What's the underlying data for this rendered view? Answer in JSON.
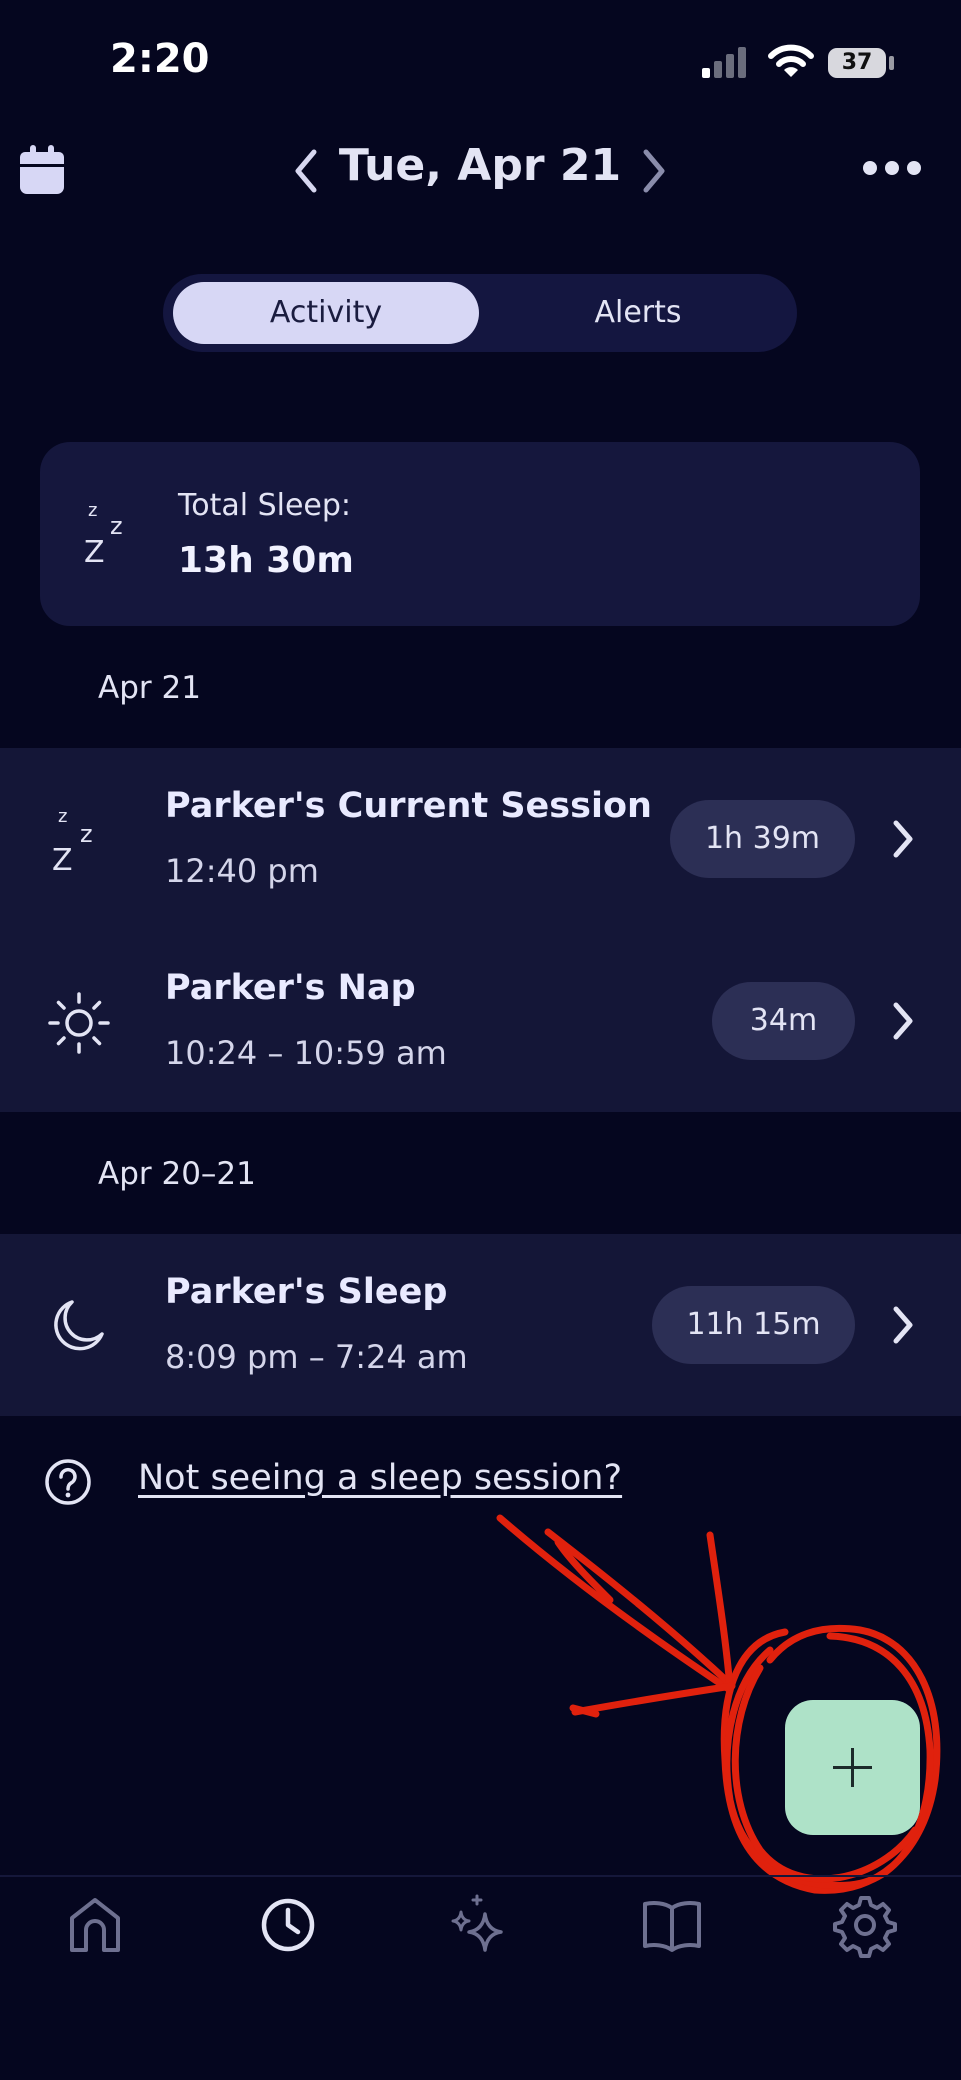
{
  "status_bar": {
    "time": "2:20",
    "battery": "37"
  },
  "header": {
    "title": "Tue, Apr 21"
  },
  "tabs": [
    {
      "label": "Activity",
      "selected": true
    },
    {
      "label": "Alerts",
      "selected": false
    }
  ],
  "summary": {
    "label": "Total Sleep:",
    "value": "13h 30m"
  },
  "sections": [
    {
      "header": "Apr 21",
      "items": [
        {
          "title": "Parker's Current Session",
          "time": "12:40 pm",
          "duration": "1h 39m",
          "icon": "zzz-icon"
        },
        {
          "title": "Parker's Nap",
          "time": "10:24 – 10:59 am",
          "duration": "34m",
          "icon": "sun-icon"
        }
      ]
    },
    {
      "header": "Apr 20–21",
      "items": [
        {
          "title": "Parker's Sleep",
          "time": "8:09 pm – 7:24 am",
          "duration": "11h 15m",
          "icon": "moon-icon"
        }
      ]
    }
  ],
  "help": {
    "link_text": "Not seeing a sleep session?"
  },
  "fab": {
    "icon": "plus-icon"
  },
  "bottom_nav": [
    {
      "icon": "home-icon",
      "active": false
    },
    {
      "icon": "clock-icon",
      "active": true
    },
    {
      "icon": "sparkle-icon",
      "active": false
    },
    {
      "icon": "book-icon",
      "active": false
    },
    {
      "icon": "gear-icon",
      "active": false
    }
  ],
  "colors": {
    "background": "#05061f",
    "accent": "#aee2c8",
    "annotation": "#e0210d"
  }
}
